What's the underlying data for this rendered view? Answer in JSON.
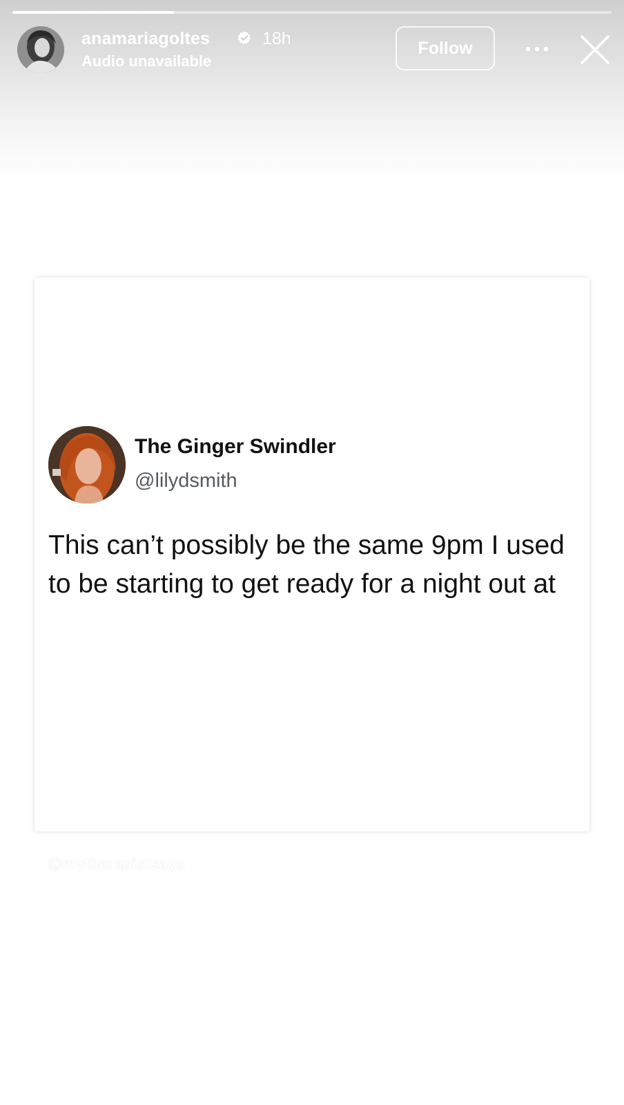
{
  "story": {
    "progress": 0.27,
    "header": {
      "username": "anamariagoltes",
      "verified": true,
      "time_ago": "18h",
      "audio_status": "Audio unavailable",
      "follow_label": "Follow",
      "more_icon": "more-horizontal-icon",
      "close_icon": "close-icon"
    }
  },
  "tweet": {
    "display_name": "The Ginger Swindler",
    "handle": "@lilydsmith",
    "text": "This can’t possibly be the same 9pm I used to be starting to get ready for a night out at"
  },
  "watermark": "@mytherapistsays",
  "colors": {
    "verified_badge": "#ffffff",
    "header_gradient_top": "#cfcfcf",
    "tweet_text": "#111111",
    "handle_text": "#555a60"
  }
}
